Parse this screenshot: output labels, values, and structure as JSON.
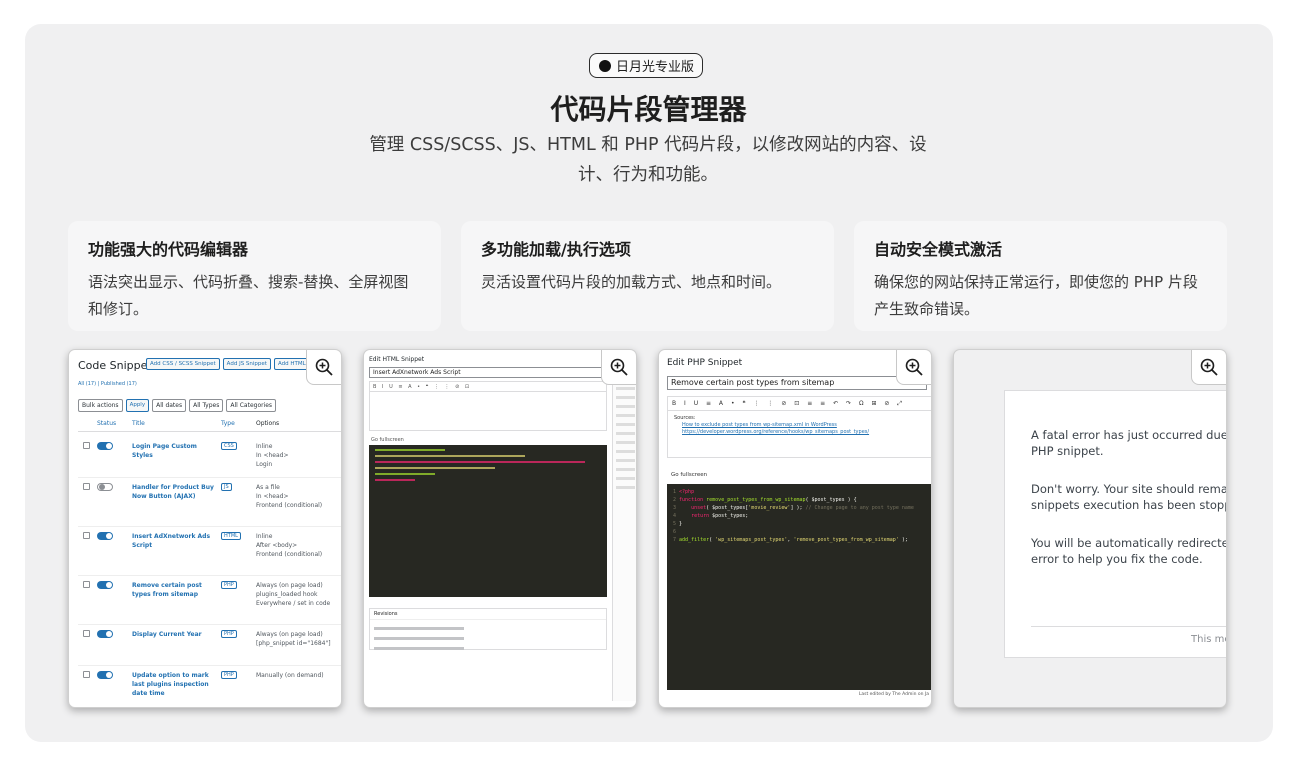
{
  "badge": {
    "label": "日月光专业版"
  },
  "hero": {
    "title": "代码片段管理器",
    "subtitle": "管理 CSS/SCSS、JS、HTML 和 PHP 代码片段，以修改网站的内容、设计、行为和功能。"
  },
  "features": [
    {
      "title": "功能强大的代码编辑器",
      "desc": "语法突出显示、代码折叠、搜索-替换、全屏视图和修订。"
    },
    {
      "title": "多功能加载/执行选项",
      "desc": "灵活设置代码片段的加载方式、地点和时间。"
    },
    {
      "title": "自动安全模式激活",
      "desc": "确保您的网站保持正常运行，即使您的 PHP 片段产生致命错误。"
    }
  ],
  "shot1": {
    "heading": "Code Snippets",
    "buttons": [
      "Add CSS / SCSS Snippet",
      "Add JS Snippet",
      "Add HTML"
    ],
    "filter": "All (17) | Published (17)",
    "bulk": "Bulk actions",
    "apply": "Apply",
    "dates": "All dates",
    "types": "All Types",
    "cats": "All Categories",
    "columns": [
      "Status",
      "Title",
      "Type",
      "Options"
    ],
    "rows": [
      {
        "title": "Login Page Custom Styles",
        "type": "CSS",
        "options": "Inline\nIn <head>\nLogin",
        "on": true
      },
      {
        "title": "Handler for Product Buy Now Button (AJAX)",
        "type": "JS",
        "options": "As a file\nIn <head>\nFrontend (conditional)",
        "on": false
      },
      {
        "title": "Insert AdXnetwork Ads Script",
        "type": "HTML",
        "options": "Inline\nAfter <body>\nFrontend (conditional)",
        "on": true
      },
      {
        "title": "Remove certain post types from sitemap",
        "type": "PHP",
        "options": "Always (on page load)\nplugins_loaded hook\nEverywhere / set in code",
        "on": true
      },
      {
        "title": "Display Current Year",
        "type": "PHP",
        "options": "Always (on page load)\n[php_snippet id=\"1684\"]",
        "on": true
      },
      {
        "title": "Update option to mark last plugins inspection date time",
        "type": "PHP",
        "options": "Manually (on demand)",
        "on": true
      }
    ]
  },
  "shot2": {
    "heading": "Edit HTML Snippet",
    "name": "Insert AdXnetwork Ads Script",
    "fullscreen": "Go fullscreen",
    "revisions": "Revisions"
  },
  "shot3": {
    "heading": "Edit PHP Snippet",
    "name": "Remove certain post types from sitemap",
    "sources": "Sources:",
    "link1": "How to exclude post types from wp-sitemap.xml in WordPress",
    "link2": "https://developer.wordpress.org/reference/hooks/wp_sitemaps_post_types/",
    "fullscreen": "Go fullscreen",
    "footer": "Last edited by The Admin on Ja"
  },
  "shot4": {
    "line1": "A fatal error has just occurred due to",
    "line2": "PHP snippet.",
    "line3": "Don't worry. Your site should remain a",
    "line4": "snippets execution has been stopped",
    "line5": "You will be automatically redirected to",
    "line6": "error to help you fix the code.",
    "footer": "This me"
  }
}
